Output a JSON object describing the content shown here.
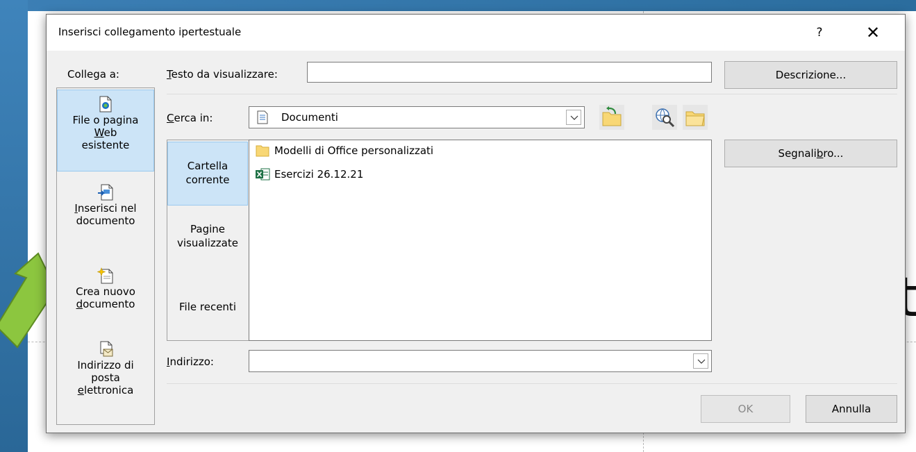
{
  "dialog": {
    "title": "Inserisci collegamento ipertestuale",
    "help": "?",
    "close": "✕"
  },
  "link_to": {
    "label": "Collega a:",
    "items": [
      {
        "line1": "File o pagina",
        "line2_u": "W",
        "line2_rest": "eb",
        "line3": "esistente",
        "selected": true,
        "icon": "existing-file-icon"
      },
      {
        "line1_u": "I",
        "line1_rest": "nserisci nel",
        "line2": "documento",
        "selected": false,
        "icon": "place-in-document-icon"
      },
      {
        "line1": "Crea nuovo",
        "line2_u": "d",
        "line2_rest": "ocumento",
        "selected": false,
        "icon": "new-document-icon"
      },
      {
        "line1": "Indirizzo di",
        "line2": "posta",
        "line3_u": "e",
        "line3_rest": "lettronica",
        "selected": false,
        "icon": "email-address-icon"
      }
    ]
  },
  "text_to_display": {
    "label_u": "T",
    "label_rest": "esto da visualizzare:",
    "value": ""
  },
  "buttons": {
    "description": "Descrizione...",
    "bookmark": "Segnalibro...",
    "ok": "OK",
    "cancel": "Annulla"
  },
  "look_in": {
    "label_u": "C",
    "label_rest": "erca in:",
    "value": "Documenti"
  },
  "browse_tabs": [
    {
      "line1": "Cartella",
      "line2": "corrente",
      "selected": true
    },
    {
      "line1": "Pagine",
      "line2": "visualizzate",
      "selected": false
    },
    {
      "line1": "File recenti",
      "line2": "",
      "selected": false
    }
  ],
  "files": [
    {
      "name": "Modelli di Office personalizzati",
      "icon": "folder-icon"
    },
    {
      "name": "Esercizi 26.12.21",
      "icon": "excel-file-icon"
    }
  ],
  "address": {
    "label_u": "I",
    "label_rest": "ndirizzo:",
    "value": ""
  },
  "colors": {
    "selection": "#cce4f7",
    "arrow": "#8cc63f",
    "folder": "#f8d775",
    "excel": "#1e7145"
  }
}
